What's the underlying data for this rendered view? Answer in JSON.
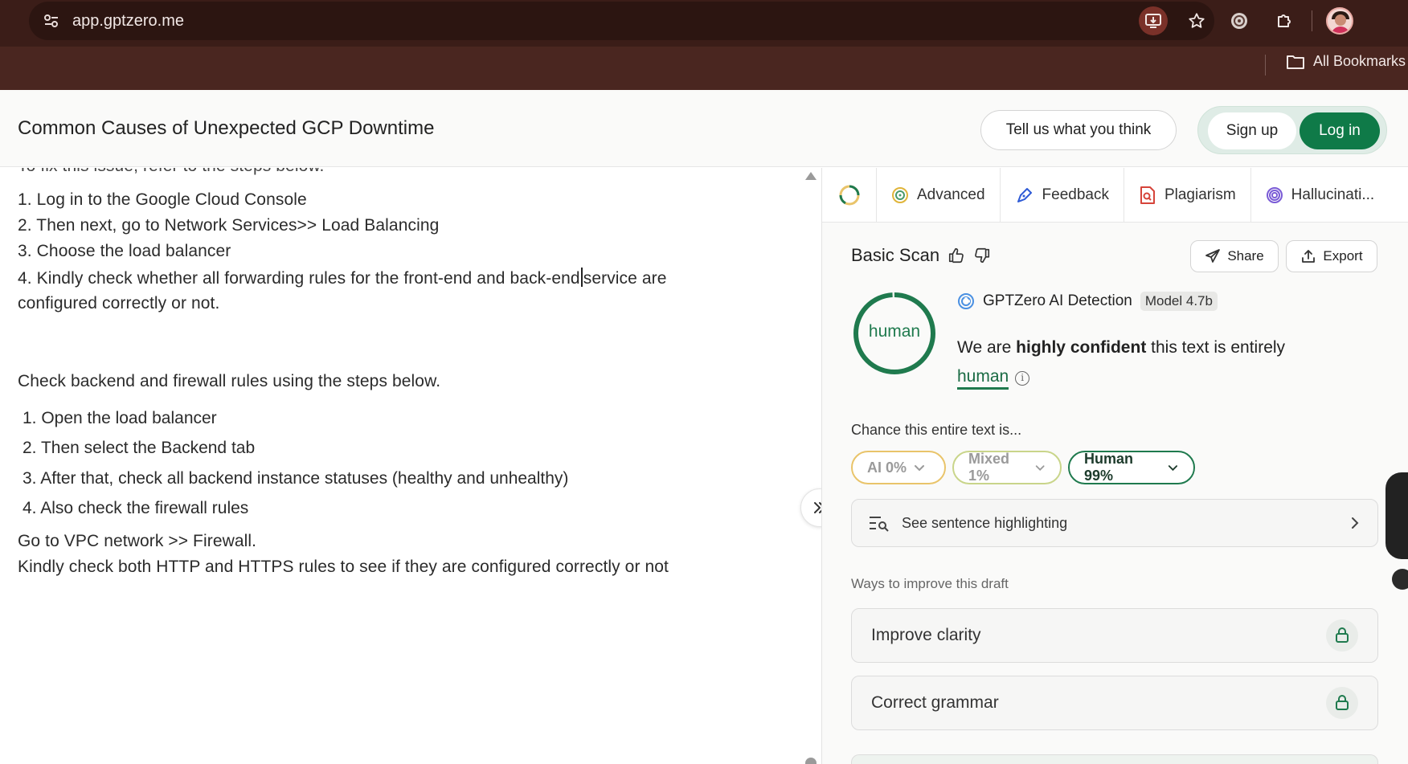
{
  "browser": {
    "url": "app.gptzero.me",
    "bookmarks_label": "All Bookmarks"
  },
  "header": {
    "doc_title": "Common Causes of Unexpected GCP Downtime",
    "feedback_button": "Tell us what you think",
    "signup_button": "Sign up",
    "login_button": "Log in"
  },
  "editor": {
    "cut_line": "To fix this issue, refer to the steps below.",
    "steps_a": [
      "1. Log in to the Google Cloud Console",
      "2. Then next, go to Network Services>> Load Balancing",
      "3. Choose the load balancer",
      "4. Kindly check whether all forwarding rules for the front-end and back-end",
      "configured correctly or not."
    ],
    "steps_a_4_tail": "service are",
    "para2": "Check backend and firewall rules using the steps below.",
    "steps_b": [
      "1. Open the load balancer",
      "2. Then select the Backend tab",
      "3. After that, check all backend instance statuses (healthy and unhealthy)",
      "4. Also check the firewall rules"
    ],
    "para3": "Go to VPC network >> Firewall.",
    "para4": "Kindly check both HTTP and HTTPS rules to see if they are configured correctly or not"
  },
  "panel": {
    "tabs": [
      "Advanced",
      "Feedback",
      "Plagiarism",
      "Hallucinati..."
    ],
    "scan_title": "Basic Scan",
    "share": "Share",
    "export": "Export",
    "gauge_label": "human",
    "gauge_value": 0.99,
    "detector_name": "GPTZero AI Detection",
    "model": "Model 4.7b",
    "confidence_pre": "We are ",
    "confidence_bold": "highly confident",
    "confidence_post": " this text is entirely",
    "confidence_word": "human",
    "chance_label": "Chance this entire text is...",
    "pills": {
      "ai": "AI 0%",
      "mixed": "Mixed 1%",
      "human": "Human 99%"
    },
    "highlight": "See sentence highlighting",
    "ways_label": "Ways to improve this draft",
    "improve": [
      "Improve clarity",
      "Correct grammar"
    ]
  },
  "colors": {
    "chrome": "#3b1d18",
    "brand_green": "#0f7a48",
    "ai_pill": "#e9c46a",
    "mixed_pill": "#c9d58a",
    "human_pill": "#1f7a4e"
  }
}
